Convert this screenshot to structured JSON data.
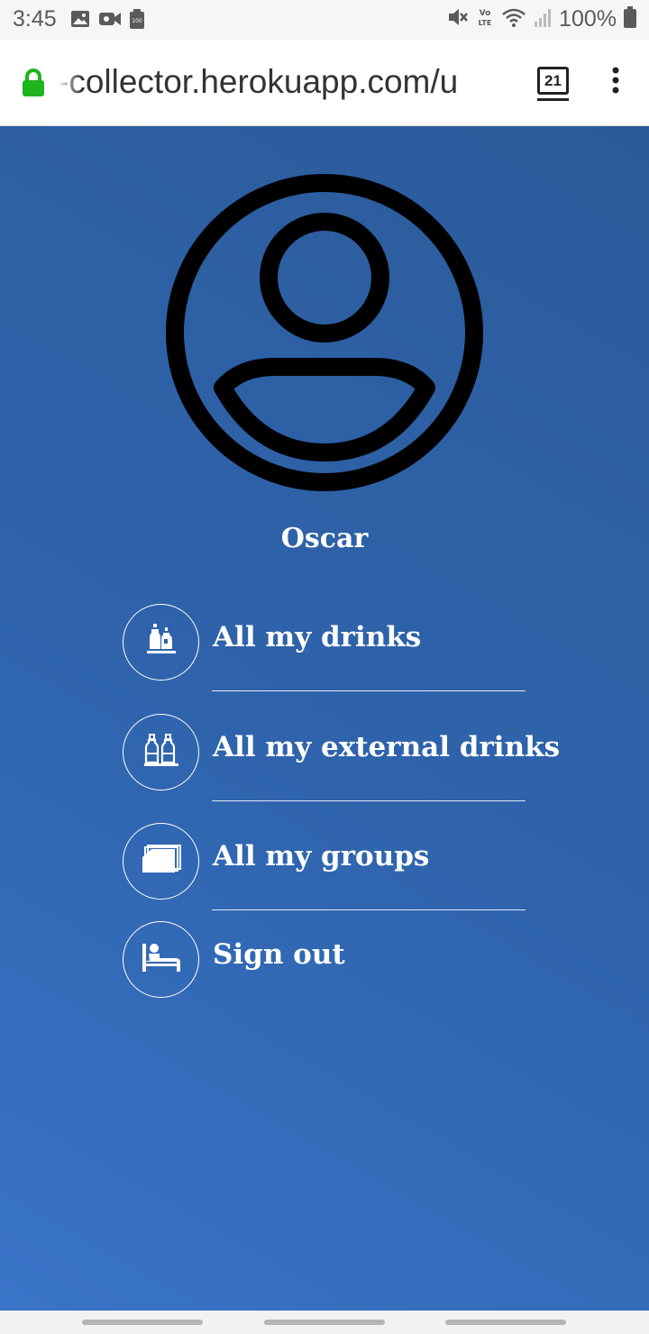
{
  "status_bar": {
    "time": "3:45",
    "battery_text": "100%",
    "left_icons": [
      "image-icon",
      "video-camera-icon",
      "battery-saver-icon"
    ],
    "right_icons": [
      "mute-icon",
      "volte-icon",
      "wifi-icon",
      "signal-icon",
      "battery-icon"
    ]
  },
  "browser": {
    "url": "-collector.herokuapp.com/u",
    "tab_count": "21",
    "lock_color": "#1db41d"
  },
  "profile": {
    "name": "Oscar"
  },
  "menu": {
    "items": [
      {
        "label": "All my drinks",
        "icon": "bottles-on-shelf-icon"
      },
      {
        "label": "All my external drinks",
        "icon": "bottles-icon"
      },
      {
        "label": "All my groups",
        "icon": "stacked-cards-icon"
      },
      {
        "label": "Sign out",
        "icon": "bed-icon"
      }
    ]
  },
  "colors": {
    "background_start": "#3a74c8",
    "background_end": "#2b5b9a",
    "text": "#ffffff"
  }
}
